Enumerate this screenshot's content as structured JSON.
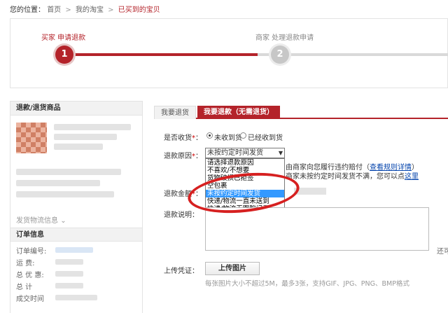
{
  "breadcrumb": {
    "prefix": "您的位置：",
    "items": [
      "首页",
      "我的淘宝"
    ],
    "current": "已买到的宝贝",
    "separator": ">"
  },
  "steps": {
    "progress": 0.5,
    "items": [
      {
        "number": "1",
        "label": "买家 申请退款"
      },
      {
        "number": "2",
        "label": "商家 处理退款申请"
      }
    ]
  },
  "sidebar": {
    "product_heading": "退款/退货商品",
    "logistics_link": "发货物流信息",
    "order_heading": "订单信息",
    "order_fields": [
      "订单编号:",
      "运    费:",
      "总 优 惠:",
      "总    计",
      "成交时间"
    ]
  },
  "tabs": [
    {
      "label": "我要退货"
    },
    {
      "label": "我要退款（无需退货）"
    }
  ],
  "form": {
    "received_label": "是否收货",
    "received_options": [
      "未收到货",
      "已经收到货"
    ],
    "reason_label": "退款原因",
    "reason_selected": "未按约定时间发货",
    "reason_options": [
      "请选择退款原因",
      "不喜欢/不想要",
      "货物破损已拒签",
      "空包裹",
      "未按约定时间发货",
      "快递/物流一直未送到",
      "快递/物流无跟踪记录"
    ],
    "reason_note_1_prefix": "由商家向您履行违约赔付（",
    "reason_note_1_link": "查看规则详情",
    "reason_note_1_suffix": "）",
    "reason_note_2_prefix": "商家未按约定时间发货不满，您可以点",
    "reason_note_2_link": "这里",
    "amount_label": "退款金额",
    "description_label": "退款说明",
    "limit_text": "还可",
    "upload_label": "上传凭证",
    "upload_button": "上传图片",
    "upload_hint": "每张图片大小不超过5M，最多3张，支持GIF、JPG、PNG、BMP格式"
  },
  "colors": {
    "accent": "#b4232a",
    "highlight": "#3399ff",
    "annotation": "#d62020"
  }
}
